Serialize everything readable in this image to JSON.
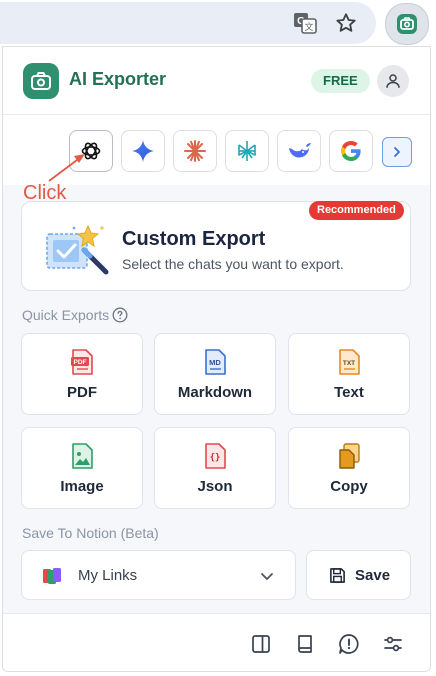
{
  "app": {
    "title": "AI Exporter",
    "plan_badge": "FREE",
    "brand_color": "#2f8f6f"
  },
  "annotation": {
    "text": "Click",
    "color": "#e45846"
  },
  "models": {
    "items": [
      {
        "name": "ChatGPT",
        "icon": "openai-icon"
      },
      {
        "name": "Gemini",
        "icon": "gemini-sparkle-icon"
      },
      {
        "name": "Claude",
        "icon": "claude-starburst-icon"
      },
      {
        "name": "Perplexity",
        "icon": "perplexity-icon"
      },
      {
        "name": "DeepSeek",
        "icon": "deepseek-whale-icon"
      },
      {
        "name": "Google",
        "icon": "google-g-icon"
      }
    ],
    "next_icon": "chevron-right-icon"
  },
  "custom_export": {
    "badge": "Recommended",
    "title": "Custom Export",
    "description": "Select the chats you want to export."
  },
  "quick_exports": {
    "label": "Quick Exports",
    "items": [
      {
        "label": "PDF",
        "icon": "pdf-file-icon",
        "color": "#e5484d"
      },
      {
        "label": "Markdown",
        "icon": "md-file-icon",
        "color": "#3b6fd4"
      },
      {
        "label": "Text",
        "icon": "txt-file-icon",
        "color": "#e58a1f"
      },
      {
        "label": "Image",
        "icon": "image-file-icon",
        "color": "#2f9e6a"
      },
      {
        "label": "Json",
        "icon": "json-file-icon",
        "color": "#e5484d"
      },
      {
        "label": "Copy",
        "icon": "copy-icon",
        "color": "#e59a1f"
      }
    ]
  },
  "notion": {
    "label": "Save To Notion (Beta)",
    "selected": "My Links",
    "save_label": "Save"
  },
  "footer": {
    "icons": [
      "sidebar-panel-icon",
      "book-icon",
      "feedback-icon",
      "settings-sliders-icon"
    ]
  }
}
